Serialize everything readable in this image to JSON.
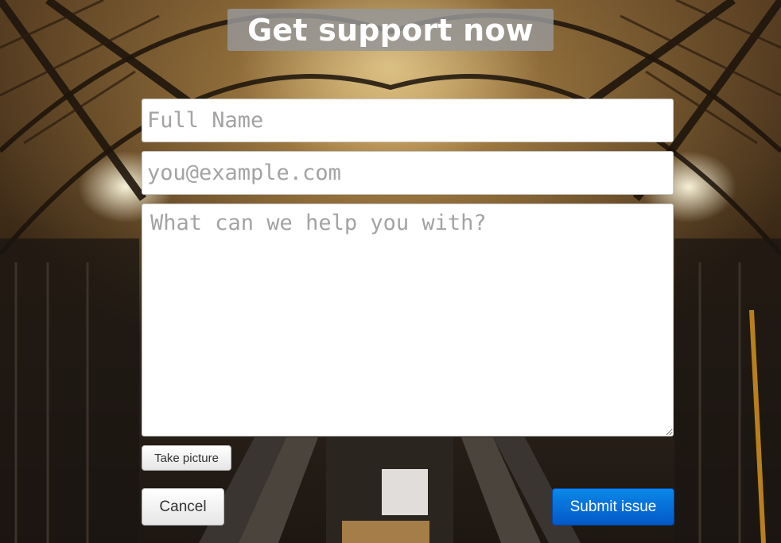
{
  "header": {
    "title": "Get support now"
  },
  "form": {
    "name_placeholder": "Full Name",
    "name_value": "",
    "email_placeholder": "you@example.com",
    "email_value": "",
    "message_placeholder": "What can we help you with?",
    "message_value": ""
  },
  "buttons": {
    "take_picture_label": "Take picture",
    "cancel_label": "Cancel",
    "submit_label": "Submit issue"
  },
  "colors": {
    "accent": "#0a6ee0",
    "title_background": "#969696"
  }
}
